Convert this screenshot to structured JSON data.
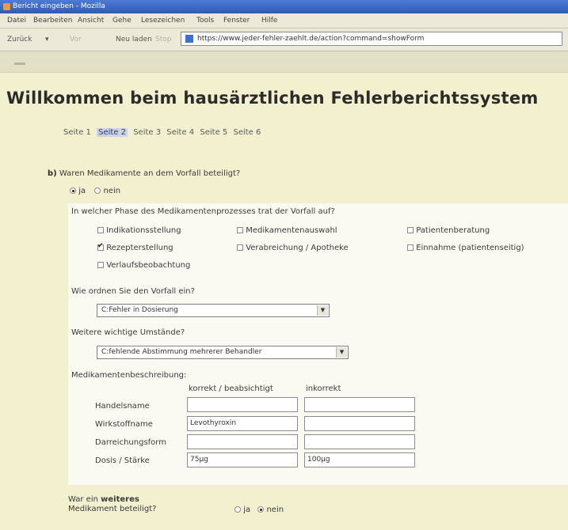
{
  "window": {
    "title": "Bericht eingeben - Mozilla"
  },
  "menu": [
    "Datei",
    "Bearbeiten",
    "Ansicht",
    "Gehe",
    "Lesezeichen",
    "Tools",
    "Fenster",
    "Hilfe"
  ],
  "nav": {
    "back": "Zurück",
    "back_dropdown": "▾",
    "forward": "Vor",
    "reload": "Neu laden",
    "stop": "Stop",
    "url": "https://www.jeder-fehler-zaehlt.de/action?command=showForm"
  },
  "page": {
    "heading": "Willkommen beim hausärztlichen Fehlerberichtssystem",
    "pages": [
      "Seite 1",
      "Seite 2",
      "Seite 3",
      "Seite 4",
      "Seite 5",
      "Seite 6"
    ],
    "current_page": "Seite 2"
  },
  "question_b": {
    "letter": "b)",
    "text": "Waren Medikamente an dem Vorfall beteiligt?",
    "yes": "ja",
    "no": "nein",
    "selected": "ja"
  },
  "phase": {
    "question": "In welcher Phase des Medikamentenprozesses trat der Vorfall auf?",
    "options": [
      {
        "label": "Indikationsstellung",
        "checked": false
      },
      {
        "label": "Medikamentenauswahl",
        "checked": false
      },
      {
        "label": "Patientenberatung",
        "checked": false
      },
      {
        "label": "Rezepterstellung",
        "checked": true
      },
      {
        "label": "Verabreichung / Apotheke",
        "checked": false
      },
      {
        "label": "Einnahme (patientenseitig)",
        "checked": false
      },
      {
        "label": "Verlaufsbeobachtung",
        "checked": false
      }
    ]
  },
  "classification": {
    "question": "Wie ordnen Sie den Vorfall ein?",
    "value": "C:Fehler in Dosierung"
  },
  "further": {
    "question": "Weitere wichtige Umstände?",
    "value": "C:fehlende Abstimmung mehrerer Behandler"
  },
  "medication": {
    "question": "Medikamentenbeschreibung:",
    "col_correct": "korrekt / beabsichtigt",
    "col_incorrect": "inkorrekt",
    "rows": [
      {
        "label": "Handelsname",
        "correct": "",
        "incorrect": ""
      },
      {
        "label": "Wirkstoffname",
        "correct": "Levothyroxin",
        "incorrect": ""
      },
      {
        "label": "Darreichungsform",
        "correct": "",
        "incorrect": ""
      },
      {
        "label": "Dosis / Stärke",
        "correct": "75µg",
        "incorrect": "100µg"
      }
    ]
  },
  "another": {
    "line1_prefix": "War ein ",
    "line1_bold": "weiteres",
    "line2": "Medikament beteiligt?",
    "yes": "ja",
    "no": "nein",
    "selected": "nein"
  }
}
